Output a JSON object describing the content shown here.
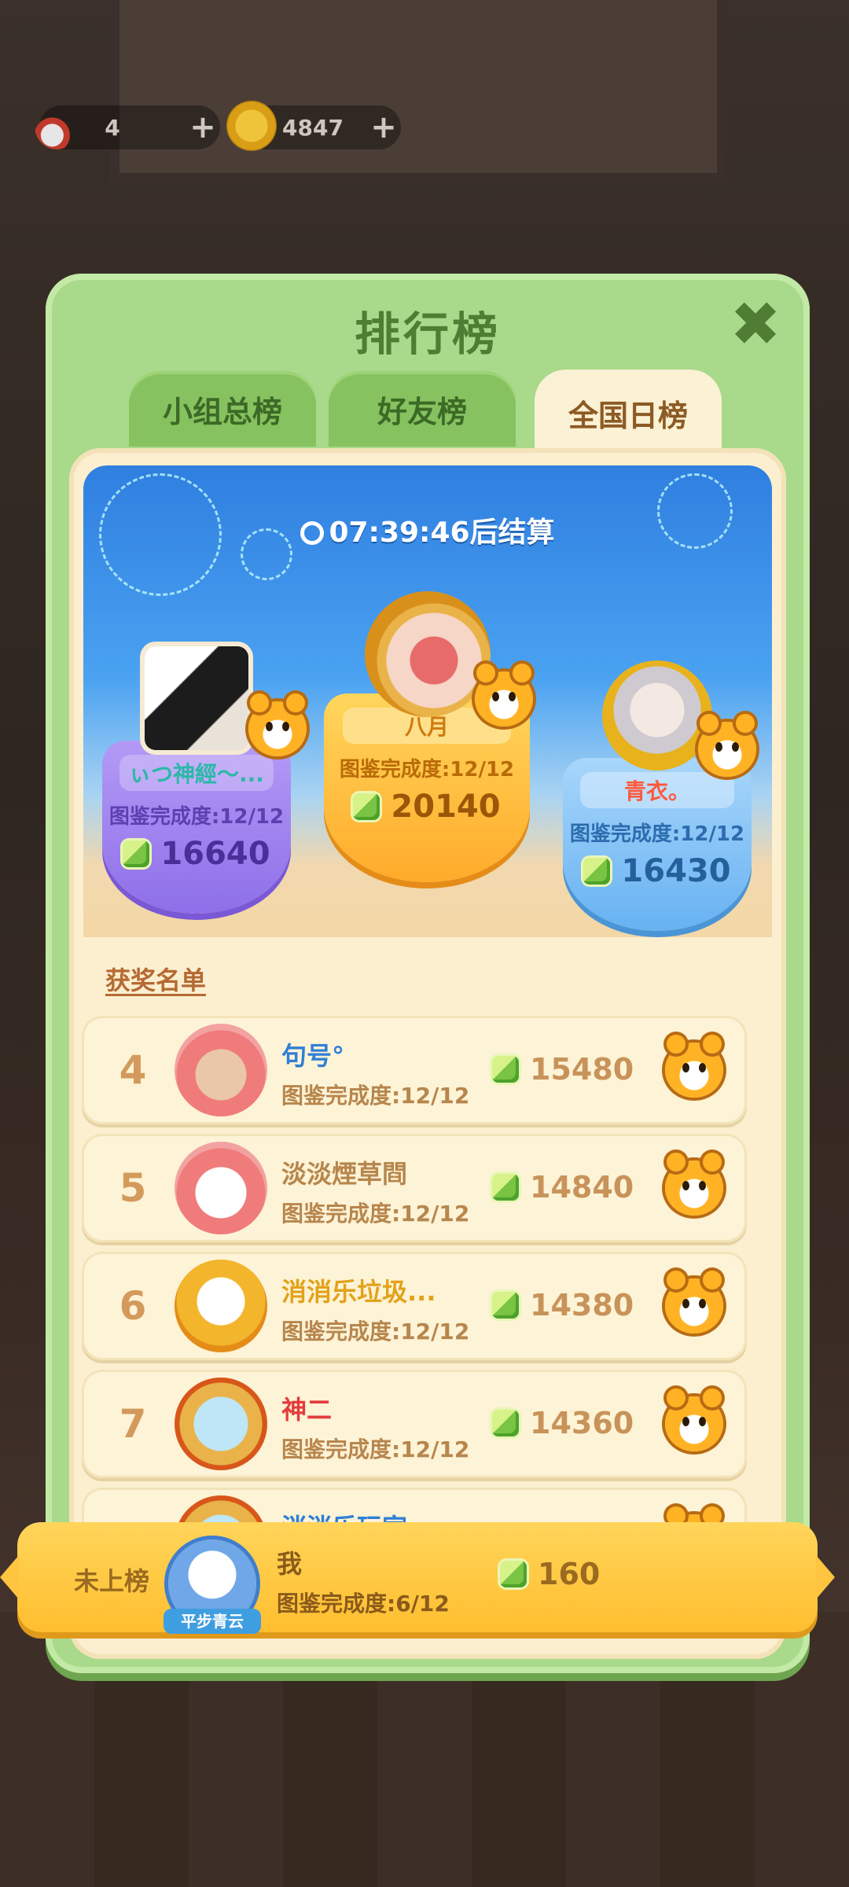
{
  "hud": {
    "pencils": {
      "icon": "pencil-icon",
      "value": "4"
    },
    "coins": {
      "icon": "coin-icon",
      "value": "4847"
    },
    "plus": "+"
  },
  "modal": {
    "title": "排行榜",
    "close_icon": "close-icon",
    "tabs": [
      {
        "label": "小组总榜",
        "active": false
      },
      {
        "label": "好友榜",
        "active": false
      },
      {
        "label": "全国日榜",
        "active": true
      }
    ],
    "timer": "07:39:46后结算",
    "podium": [
      {
        "place": 2,
        "name": "ぃつ神經～...",
        "progress": "图鉴完成度:12/12",
        "score": "16640",
        "color": "purple"
      },
      {
        "place": 1,
        "name": "八月",
        "progress": "图鉴完成度:12/12",
        "score": "20140",
        "color": "orange"
      },
      {
        "place": 3,
        "name": "青衣。",
        "progress": "图鉴完成度:12/12",
        "score": "16430",
        "color": "blue"
      }
    ],
    "section_label": "获奖名单",
    "rows": [
      {
        "rank": "4",
        "name": "句号°",
        "name_color": "#2f7fd6",
        "progress": "图鉴完成度:12/12",
        "score": "15480"
      },
      {
        "rank": "5",
        "name": "淡淡煙草閰",
        "name_color": "#b7864d",
        "progress": "图鉴完成度:12/12",
        "score": "14840"
      },
      {
        "rank": "6",
        "name": "消消乐垃圾...",
        "name_color": "#e2a21a",
        "progress": "图鉴完成度:12/12",
        "score": "14380"
      },
      {
        "rank": "7",
        "name": "神二",
        "name_color": "#e23c3c",
        "progress": "图鉴完成度:12/12",
        "score": "14360"
      },
      {
        "rank": "",
        "name": "消消乐玩家",
        "name_color": "#2f7fd6",
        "progress": "",
        "score": ""
      }
    ],
    "me": {
      "status": "未上榜",
      "badge": "平步青云",
      "name": "我",
      "progress": "图鉴完成度:6/12",
      "score": "160"
    }
  }
}
